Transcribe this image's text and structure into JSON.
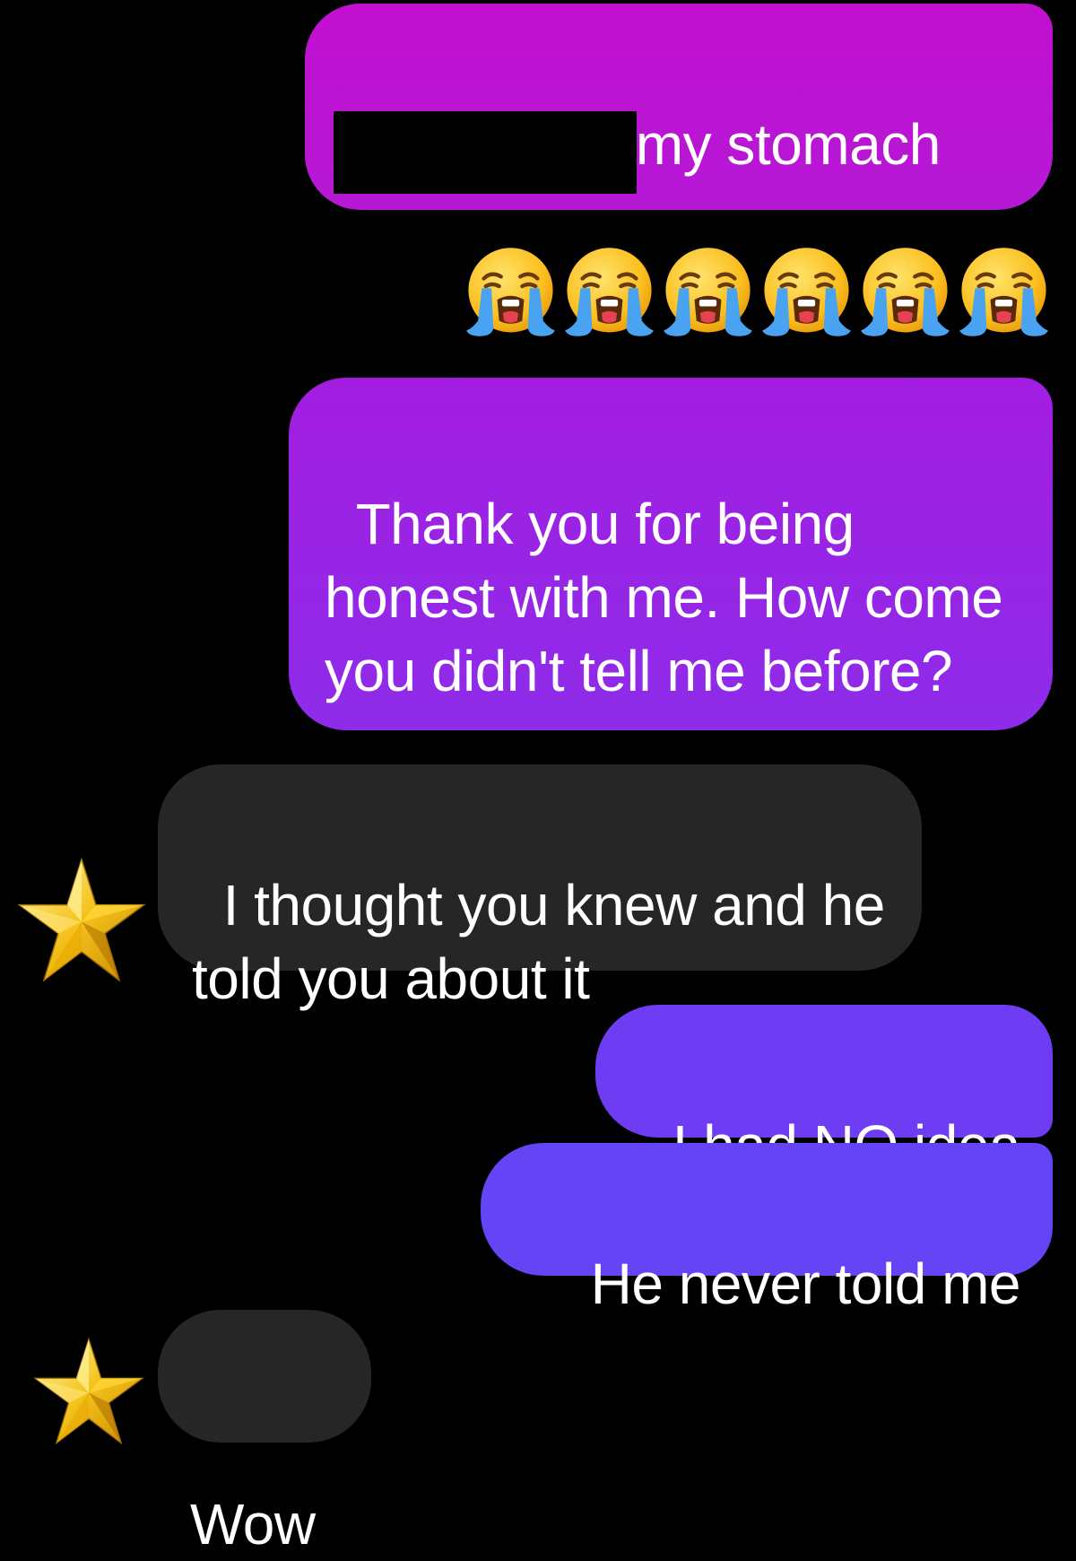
{
  "conversation": {
    "messages": [
      {
        "sender": "me",
        "text": "I'm sick to my stomach",
        "redacted": true
      },
      {
        "sender": "me",
        "text": "😭😭😭😭😭😭",
        "emoji_count": 6,
        "emoji_name": "loudly-crying-face"
      },
      {
        "sender": "me",
        "text": "Thank you for being honest with me. How come you didn't tell me before?"
      },
      {
        "sender": "other",
        "text": "I thought you knew and he told you about it",
        "avatar": "star-icon"
      },
      {
        "sender": "me",
        "text": "I had NO idea"
      },
      {
        "sender": "me",
        "text": "He never told me"
      },
      {
        "sender": "other",
        "text": "Wow",
        "avatar": "star-icon"
      }
    ]
  },
  "colors": {
    "background": "#000000",
    "sent_bubble_top": "#c20fd0",
    "sent_bubble_mid": "#9d22e4",
    "sent_bubble_bottom": "#6444f4",
    "received_bubble": "#262626",
    "text": "#ffffff"
  }
}
